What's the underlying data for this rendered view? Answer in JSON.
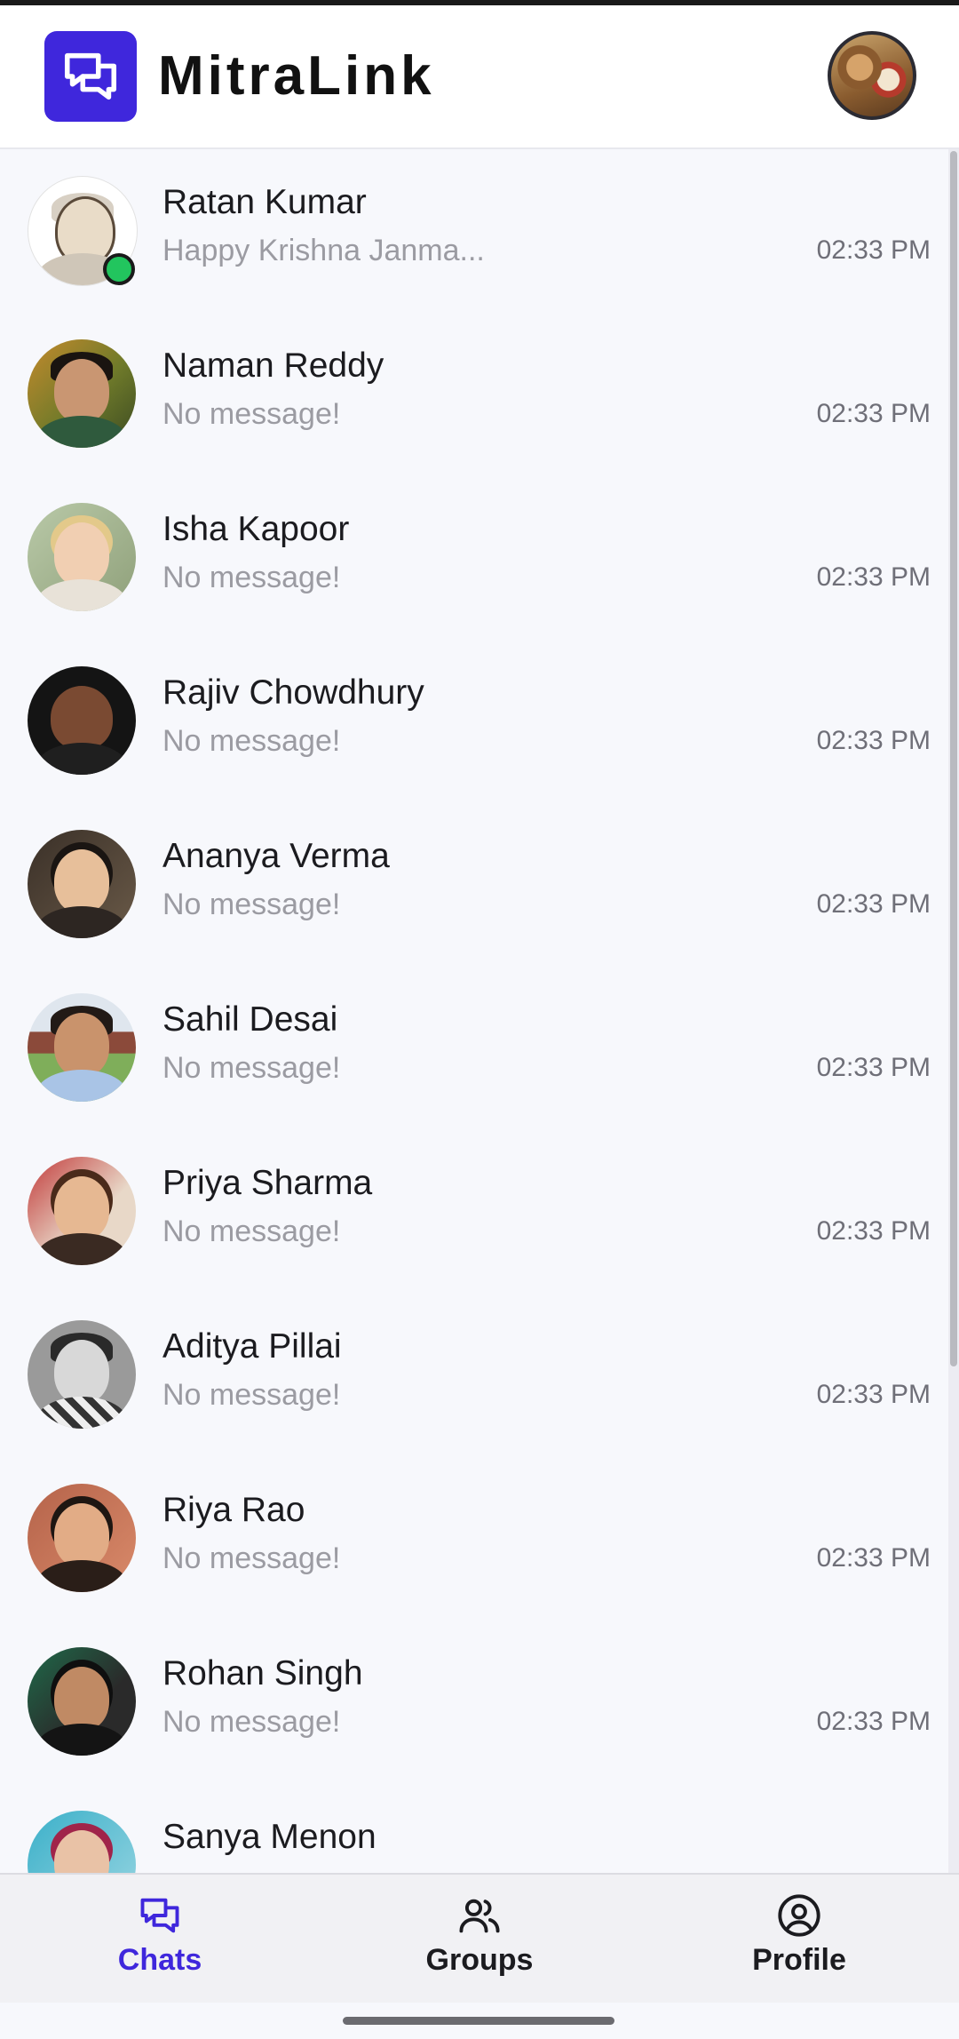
{
  "app": {
    "title": "MitraLink",
    "accent_color": "#3f27dc",
    "online_color": "#22c55e"
  },
  "header": {
    "logo_icon": "chat-bubbles-icon",
    "profile_avatar": "user-avatar"
  },
  "chats": [
    {
      "name": "Ratan Kumar",
      "preview": "Happy Krishna Janma...",
      "time": "02:33 PM",
      "online": true
    },
    {
      "name": "Naman Reddy",
      "preview": "No message!",
      "time": "02:33 PM",
      "online": false
    },
    {
      "name": "Isha Kapoor",
      "preview": "No message!",
      "time": "02:33 PM",
      "online": false
    },
    {
      "name": "Rajiv Chowdhury",
      "preview": "No message!",
      "time": "02:33 PM",
      "online": false
    },
    {
      "name": "Ananya Verma",
      "preview": "No message!",
      "time": "02:33 PM",
      "online": false
    },
    {
      "name": "Sahil Desai",
      "preview": "No message!",
      "time": "02:33 PM",
      "online": false
    },
    {
      "name": "Priya Sharma",
      "preview": "No message!",
      "time": "02:33 PM",
      "online": false
    },
    {
      "name": "Aditya Pillai",
      "preview": "No message!",
      "time": "02:33 PM",
      "online": false
    },
    {
      "name": "Riya Rao",
      "preview": "No message!",
      "time": "02:33 PM",
      "online": false
    },
    {
      "name": "Rohan Singh",
      "preview": "No message!",
      "time": "02:33 PM",
      "online": false
    },
    {
      "name": "Sanya Menon",
      "preview": "",
      "time": "",
      "online": false
    }
  ],
  "bottom_nav": {
    "items": [
      {
        "label": "Chats",
        "icon": "chat-bubbles-icon",
        "active": true
      },
      {
        "label": "Groups",
        "icon": "users-icon",
        "active": false
      },
      {
        "label": "Profile",
        "icon": "user-circle-icon",
        "active": false
      }
    ]
  }
}
